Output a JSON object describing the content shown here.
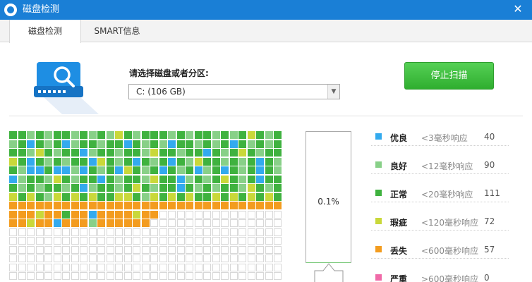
{
  "window": {
    "title": "磁盘检测",
    "close_glyph": "✕"
  },
  "tabs": [
    {
      "label": "磁盘检测",
      "active": true
    },
    {
      "label": "SMART信息",
      "active": false
    }
  ],
  "icons": {
    "app": "app-shield-icon",
    "disk": "disk-magnifier-icon",
    "close": "close-icon",
    "dropdown": "chevron-down-icon"
  },
  "selector": {
    "label": "请选择磁盘或者分区:",
    "value": "C:  (106 GB)",
    "arrow_glyph": "▼"
  },
  "stop_button": {
    "label": "停止扫描",
    "color": "#3cb93c"
  },
  "progress": {
    "value": 0.001,
    "text": "0.1%"
  },
  "legend": [
    {
      "key": "excellent",
      "name": "优良",
      "desc": "<3毫秒响应",
      "count": "40",
      "color": "#33aaee"
    },
    {
      "key": "good",
      "name": "良好",
      "desc": "<12毫秒响应",
      "count": "90",
      "color": "#88d088"
    },
    {
      "key": "normal",
      "name": "正常",
      "desc": "<20毫秒响应",
      "count": "111",
      "color": "#3fb23f"
    },
    {
      "key": "flaw",
      "name": "瑕疵",
      "desc": "<120毫秒响应",
      "count": "72",
      "color": "#c9d83a"
    },
    {
      "key": "lost",
      "name": "丢失",
      "desc": "<600毫秒响应",
      "count": "57",
      "color": "#f39c1f"
    },
    {
      "key": "severe",
      "name": "严重",
      "desc": ">600毫秒响应",
      "count": "0",
      "color": "#f06aa8"
    }
  ],
  "block_grid": {
    "columns": 31,
    "empty_color": "#ffffff",
    "rows": [
      "GGLGLGGLGLGLYGLGGGLGLGGLGLGYGLG",
      "LGBGLGBLGGLGGBGLGLBGGLGLGBGLGLG",
      "GGLYGLGGBLGGLGGLYGGLGGBGLGYGLGG",
      "YGBGLGLGGBYGLGBGLGBGLYGGLGLGBGL",
      "GLBBGBBLBGLGBYGLGBGLGBLGBGLGBGL",
      "BLGGLYGLGGBGLGGLYGGBLGLGYGLGBGG",
      "GLGLGGLGBLGGLGYGLGGBGLGLGGLYGLG",
      "YGYGLYGYGYGGYYGLYGYGYGGYGYGYGYG",
      "OOOOOOOOOOOOOOOOOOOOOOOOOOOOOOO",
      "OOOYOOGOOBOOOOYOOEEEEEEEEEEEEEE",
      "OOYOOBOOOLOOOOOOEEEEEEEEEEEEEEE",
      "EEEEEEEEEEEEEEEEEEEEEEEEEEEEEEE",
      "EEEEEEEEEEEEEEEEEEEEEEEEEEEEEEE",
      "EEEEEEEEEEEEEEEEEEEEEEEEEEEEEEE",
      "EEEEEEEEEEEEEEEEEEEEEEEEEEEEEEE",
      "EEEEEEEEEEEEEEEEEEEEEEEEEEEEEEE",
      "EEEEEEEEEEEEEEEEEEEEEEEEEEEEEEE"
    ],
    "legend": {
      "B": "excellent",
      "L": "good",
      "G": "normal",
      "Y": "flaw",
      "O": "lost",
      "E": "empty"
    }
  }
}
